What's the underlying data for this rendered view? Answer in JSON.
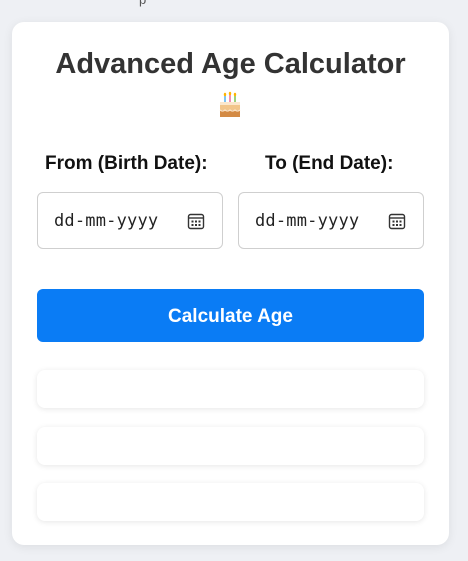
{
  "header_fragment": "p",
  "calculator": {
    "title": "Advanced Age Calculator",
    "title_icon": "birthday-cake-icon",
    "from_label": "From (Birth Date):",
    "to_label": "To (End Date):",
    "from_input": {
      "value": "",
      "placeholder": "dd-mm-yyyy",
      "icon": "calendar-icon"
    },
    "to_input": {
      "value": "",
      "placeholder": "dd-mm-yyyy",
      "icon": "calendar-icon"
    },
    "calculate_button_label": "Calculate Age",
    "results": [
      "",
      "",
      ""
    ]
  },
  "colors": {
    "accent": "#0a7cf5",
    "title_text": "#333333",
    "background": "#eef0f4"
  }
}
